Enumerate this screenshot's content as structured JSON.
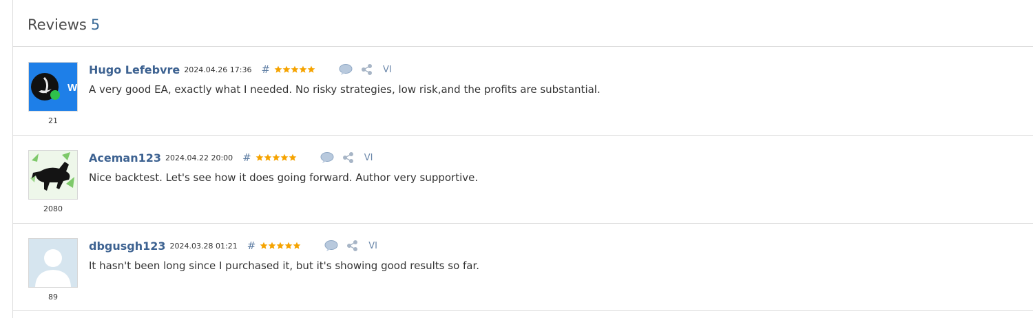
{
  "header": {
    "title": "Reviews",
    "count": "5"
  },
  "colors": {
    "link": "#3d6291",
    "star": "#f5a300",
    "divider": "#dcdcdc"
  },
  "reviews": [
    {
      "name": "Hugo Lefebvre",
      "date": "2024.04.26 17:36",
      "hash": "#",
      "stars": 5,
      "reply_icon": "speech-bubble-icon",
      "share_icon": "share-icon",
      "vi": "VI",
      "text": "A very good EA, exactly what I needed. No risky strategies, low risk,and the profits are substantial.",
      "rating_number": "21",
      "avatar_icon": "logo-avatar-icon",
      "avatar_letter": "W"
    },
    {
      "name": "Aceman123",
      "date": "2024.04.22 20:00",
      "hash": "#",
      "stars": 5,
      "reply_icon": "speech-bubble-icon",
      "share_icon": "share-icon",
      "vi": "VI",
      "text": "Nice backtest. Let's see how it does going forward. Author very supportive.",
      "rating_number": "2080",
      "avatar_icon": "bull-avatar-icon"
    },
    {
      "name": "dbgusgh123",
      "date": "2024.03.28 01:21",
      "hash": "#",
      "stars": 5,
      "reply_icon": "speech-bubble-icon",
      "share_icon": "share-icon",
      "vi": "VI",
      "text": "It hasn't been long since I purchased it, but it's showing good results so far.",
      "rating_number": "89",
      "avatar_icon": "default-user-avatar-icon"
    }
  ]
}
